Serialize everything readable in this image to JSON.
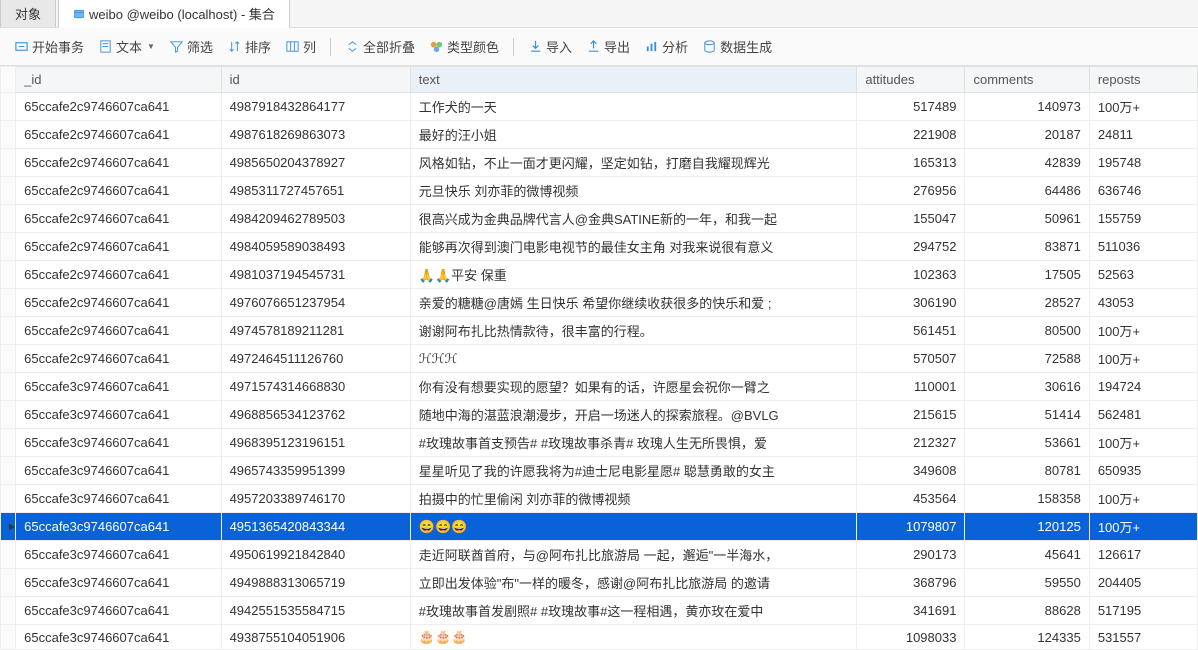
{
  "tabs": {
    "objects": "对象",
    "active_title": "weibo @weibo (localhost) - 集合"
  },
  "toolbar": {
    "begin_tx": "开始事务",
    "text": "文本",
    "filter": "筛选",
    "sort": "排序",
    "columns": "列",
    "collapse_all": "全部折叠",
    "type_color": "类型颜色",
    "import": "导入",
    "export": "导出",
    "analyze": "分析",
    "data_gen": "数据生成"
  },
  "headers": {
    "h0": "_id",
    "h1": "id",
    "h2": "text",
    "h3": "attitudes",
    "h4": "comments",
    "h5": "reposts"
  },
  "rows": [
    {
      "oid": "65ccafe2c9746607ca641",
      "id": "4987918432864177",
      "text": "工作犬的一天",
      "att": "517489",
      "com": "140973",
      "rep": "100万+"
    },
    {
      "oid": "65ccafe2c9746607ca641",
      "id": "4987618269863073",
      "text": "最好的汪小姐",
      "att": "221908",
      "com": "20187",
      "rep": "24811"
    },
    {
      "oid": "65ccafe2c9746607ca641",
      "id": "4985650204378927",
      "text": "风格如钻，不止一面才更闪耀，坚定如钻，打磨自我耀现辉光",
      "att": "165313",
      "com": "42839",
      "rep": "195748"
    },
    {
      "oid": "65ccafe2c9746607ca641",
      "id": "4985311727457651",
      "text": "元旦快乐 刘亦菲的微博视频",
      "att": "276956",
      "com": "64486",
      "rep": "636746"
    },
    {
      "oid": "65ccafe2c9746607ca641",
      "id": "4984209462789503",
      "text": "很高兴成为金典品牌代言人@金典SATINE新的一年，和我一起",
      "att": "155047",
      "com": "50961",
      "rep": "155759"
    },
    {
      "oid": "65ccafe2c9746607ca641",
      "id": "4984059589038493",
      "text": "能够再次得到澳门电影电视节的最佳女主角 对我来说很有意义",
      "att": "294752",
      "com": "83871",
      "rep": "511036"
    },
    {
      "oid": "65ccafe2c9746607ca641",
      "id": "4981037194545731",
      "text": "🙏🙏平安 保重",
      "att": "102363",
      "com": "17505",
      "rep": "52563"
    },
    {
      "oid": "65ccafe2c9746607ca641",
      "id": "4976076651237954",
      "text": "亲爱的糖糖@唐嫣 生日快乐 希望你继续收获很多的快乐和爱 ;",
      "att": "306190",
      "com": "28527",
      "rep": "43053"
    },
    {
      "oid": "65ccafe2c9746607ca641",
      "id": "4974578189211281",
      "text": "谢谢阿布扎比热情款待，很丰富的行程。",
      "att": "561451",
      "com": "80500",
      "rep": "100万+"
    },
    {
      "oid": "65ccafe2c9746607ca641",
      "id": "4972464511126760",
      "text": "ℋℋℋ",
      "att": "570507",
      "com": "72588",
      "rep": "100万+"
    },
    {
      "oid": "65ccafe3c9746607ca641",
      "id": "4971574314668830",
      "text": "你有没有想要实现的愿望？如果有的话，许愿星会祝你一臂之",
      "att": "110001",
      "com": "30616",
      "rep": "194724"
    },
    {
      "oid": "65ccafe3c9746607ca641",
      "id": "4968856534123762",
      "text": "随地中海的湛蓝浪潮漫步，开启一场迷人的探索旅程。@BVLG",
      "att": "215615",
      "com": "51414",
      "rep": "562481"
    },
    {
      "oid": "65ccafe3c9746607ca641",
      "id": "4968395123196151",
      "text": "#玫瑰故事首支预告# #玫瑰故事杀青# 玫瑰人生无所畏惧，爱",
      "att": "212327",
      "com": "53661",
      "rep": "100万+"
    },
    {
      "oid": "65ccafe3c9746607ca641",
      "id": "4965743359951399",
      "text": "星星听见了我的许愿我将为#迪士尼电影星愿# 聪慧勇敢的女主",
      "att": "349608",
      "com": "80781",
      "rep": "650935"
    },
    {
      "oid": "65ccafe3c9746607ca641",
      "id": "4957203389746170",
      "text": "拍摄中的忙里偷闲 刘亦菲的微博视频",
      "att": "453564",
      "com": "158358",
      "rep": "100万+"
    },
    {
      "oid": "65ccafe3c9746607ca641",
      "id": "4951365420843344",
      "text": "😄😄😄",
      "att": "1079807",
      "com": "120125",
      "rep": "100万+",
      "sel": true
    },
    {
      "oid": "65ccafe3c9746607ca641",
      "id": "4950619921842840",
      "text": "走近阿联酋首府，与@阿布扎比旅游局 一起，邂逅\"一半海水，",
      "att": "290173",
      "com": "45641",
      "rep": "126617"
    },
    {
      "oid": "65ccafe3c9746607ca641",
      "id": "4949888313065719",
      "text": "立即出发体验\"布\"一样的暖冬，感谢@阿布扎比旅游局 的邀请",
      "att": "368796",
      "com": "59550",
      "rep": "204405"
    },
    {
      "oid": "65ccafe3c9746607ca641",
      "id": "4942551535584715",
      "text": "#玫瑰故事首发剧照# #玫瑰故事#这一程相遇，黄亦玫在爱中",
      "att": "341691",
      "com": "88628",
      "rep": "517195"
    },
    {
      "oid": "65ccafe3c9746607ca641",
      "id": "4938755104051906",
      "text": "🎂🎂🎂",
      "att": "1098033",
      "com": "124335",
      "rep": "531557"
    }
  ]
}
